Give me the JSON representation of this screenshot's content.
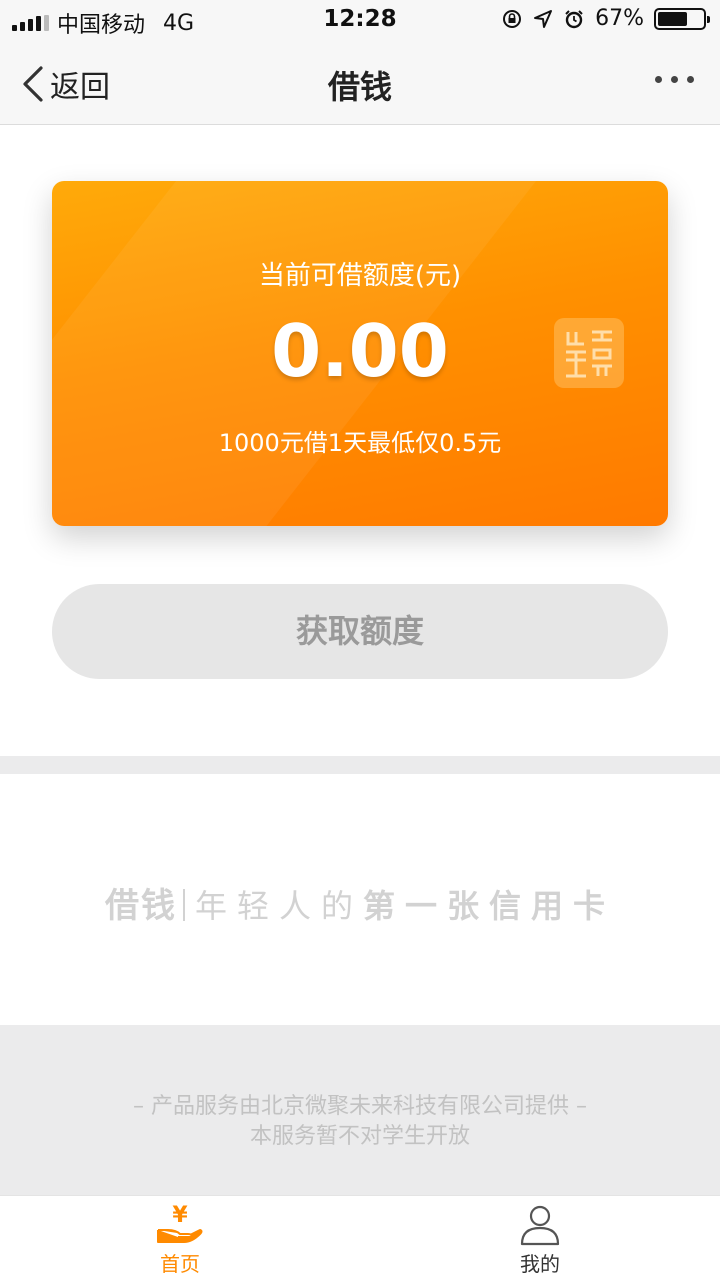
{
  "status_bar": {
    "carrier": "中国移动",
    "network": "4G",
    "time": "12:28",
    "battery": "67%",
    "battery_level": 0.67
  },
  "nav": {
    "back_label": "返回",
    "title": "借钱"
  },
  "card": {
    "label": "当前可借额度(元)",
    "amount": "0.00",
    "subtitle": "1000元借1天最低仅0.5元"
  },
  "action": {
    "button_label": "获取额度"
  },
  "slogan": {
    "brand": "借钱",
    "part_light": "年轻人的",
    "part_bold": "第一张信用卡"
  },
  "footer": {
    "line1": "– 产品服务由北京微聚未来科技有限公司提供 –",
    "line2": "本服务暂不对学生开放"
  },
  "tabs": [
    {
      "label": "首页",
      "icon": "yen-hand-icon",
      "active": true
    },
    {
      "label": "我的",
      "icon": "user-icon",
      "active": false
    }
  ],
  "colors": {
    "accent": "#ff8a00",
    "card_gradient_top": "#ffaa0a",
    "card_gradient_bottom": "#ff7a00",
    "disabled_button": "#e6e6e6"
  }
}
